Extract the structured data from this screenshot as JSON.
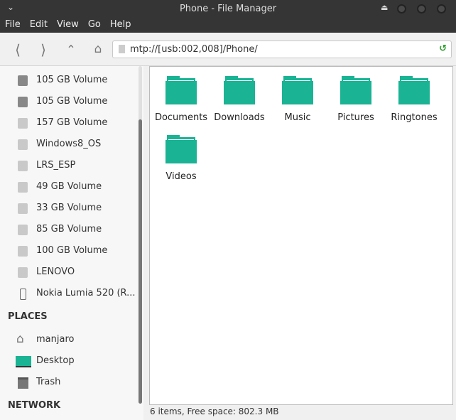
{
  "window": {
    "title": "Phone - File Manager"
  },
  "menu": [
    "File",
    "Edit",
    "View",
    "Go",
    "Help"
  ],
  "address": "mtp://[usb:002,008]/Phone/",
  "devices": [
    {
      "label": "105 GB Volume",
      "mounted": true
    },
    {
      "label": "105 GB Volume",
      "mounted": true
    },
    {
      "label": "157 GB Volume",
      "mounted": false
    },
    {
      "label": "Windows8_OS",
      "mounted": false
    },
    {
      "label": "LRS_ESP",
      "mounted": false
    },
    {
      "label": "49 GB Volume",
      "mounted": false
    },
    {
      "label": "33 GB Volume",
      "mounted": false
    },
    {
      "label": "85 GB Volume",
      "mounted": false
    },
    {
      "label": "100 GB Volume",
      "mounted": false
    },
    {
      "label": "LENOVO",
      "mounted": false
    },
    {
      "label": "Nokia Lumia 520 (R...",
      "mounted": true
    }
  ],
  "places_header": "PLACES",
  "places": [
    {
      "label": "manjaro"
    },
    {
      "label": "Desktop"
    },
    {
      "label": "Trash"
    }
  ],
  "network_header": "NETWORK",
  "folders": [
    "Documents",
    "Downloads",
    "Music",
    "Pictures",
    "Ringtones",
    "Videos"
  ],
  "status": "6 items, Free space: 802.3 MB",
  "colors": {
    "folder": "#1ab394"
  }
}
